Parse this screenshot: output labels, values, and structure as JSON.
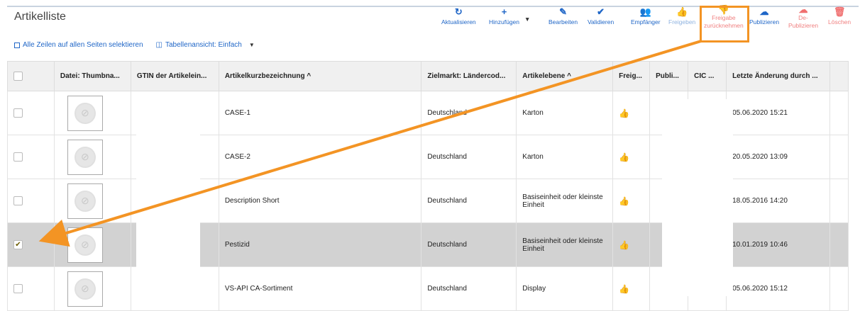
{
  "header": {
    "title": "Artikelliste",
    "select_all_label": "Alle Zeilen auf allen Seiten selektieren",
    "table_view_label": "Tabellenansicht: Einfach"
  },
  "toolbar": {
    "refresh": "Aktualisieren",
    "add": "Hinzufügen",
    "edit": "Bearbeiten",
    "validate": "Validieren",
    "recipients": "Empfänger",
    "release": "Freigeben",
    "revoke_line1": "Freigabe",
    "revoke_line2": "zurücknehmen",
    "publish": "Publizieren",
    "unpublish_line1": "De-",
    "unpublish_line2": "Publizieren",
    "delete": "Löschen"
  },
  "table": {
    "columns": [
      "",
      "Datei: Thumbna...",
      "GTIN der Artikelein...",
      "Artikelkurzbezeichnung ^",
      "Zielmarkt: Ländercod...",
      "Artikelebene ^",
      "Freig...",
      "Publi...",
      "CIC ...",
      "Letzte Änderung durch ..."
    ],
    "rows": [
      {
        "name": "CASE-1",
        "market": "Deutschland",
        "level": "Karton",
        "changed": "05.06.2020 15:21",
        "checked": false
      },
      {
        "name": "CASE-2",
        "market": "Deutschland",
        "level": "Karton",
        "changed": "20.05.2020 13:09",
        "checked": false
      },
      {
        "name": "Description Short",
        "market": "Deutschland",
        "level": "Basiseinheit oder kleinste Einheit",
        "changed": "18.05.2016 14:20",
        "checked": false
      },
      {
        "name": "Pestizid",
        "market": "Deutschland",
        "level": "Basiseinheit oder kleinste Einheit",
        "changed": "10.01.2019 10:46",
        "checked": true
      },
      {
        "name": "VS-API CA-Sortiment",
        "market": "Deutschland",
        "level": "Display",
        "changed": "05.06.2020 15:12",
        "checked": false
      }
    ]
  },
  "icons": {
    "refresh": "refresh-icon",
    "add": "plus-icon",
    "edit": "pencil-icon",
    "validate": "check-icon",
    "recipients": "users-icon",
    "release": "thumbs-up-icon",
    "revoke": "thumbs-down-icon",
    "publish": "cloud-upload-icon",
    "unpublish": "cloud-download-icon",
    "delete": "trash-icon"
  },
  "colors": {
    "accent": "#1f66c7",
    "highlight": "#f39424",
    "danger": "#f07070",
    "selected_row": "#d2d2d2"
  }
}
